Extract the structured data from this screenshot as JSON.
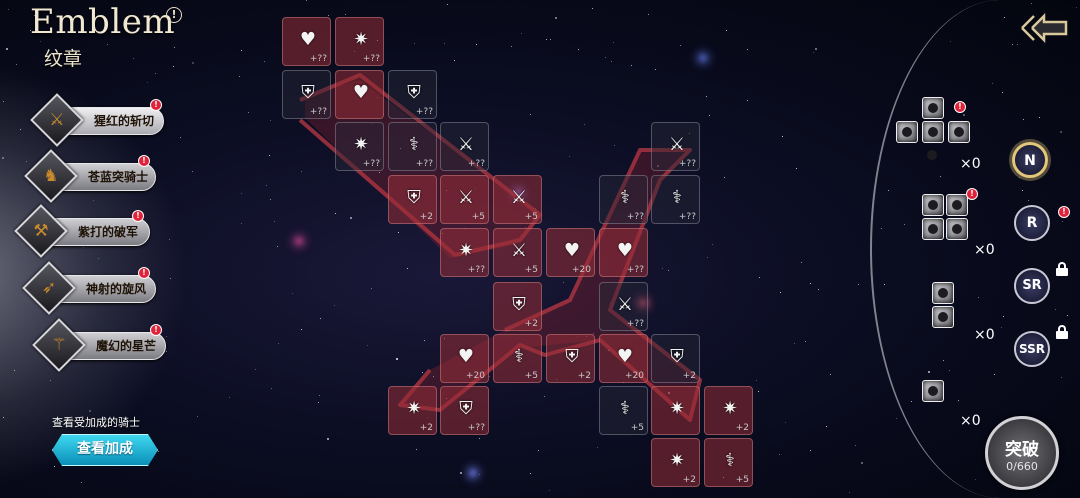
{
  "header": {
    "title": "Emblem",
    "subtitle": "纹章",
    "info_glyph": "!"
  },
  "menu": [
    {
      "label": "猩红的斩切",
      "icon": "sword-icon",
      "badge": "!"
    },
    {
      "label": "苍蓝突骑士",
      "icon": "knight-icon",
      "badge": "!"
    },
    {
      "label": "紫打的破军",
      "icon": "axe-icon",
      "badge": "!"
    },
    {
      "label": "神射的旋风",
      "icon": "bow-icon",
      "badge": "!"
    },
    {
      "label": "魔幻的星芒",
      "icon": "staff-icon",
      "badge": "!"
    }
  ],
  "view_knights": {
    "label": "查看受加成的骑士",
    "button": "查看加成"
  },
  "grid": [
    {
      "icon": "heart-icon",
      "value": "+??",
      "style": "red"
    },
    {
      "icon": "burst-icon",
      "value": "+??",
      "style": "red"
    },
    {
      "icon": "shield-icon",
      "value": "+??",
      "style": "grey"
    },
    {
      "icon": "heart-icon",
      "value": "",
      "style": "red"
    },
    {
      "icon": "shield-icon",
      "value": "+??",
      "style": "grey"
    },
    {
      "icon": "burst-icon",
      "value": "+??",
      "style": "grey"
    },
    {
      "icon": "wand-icon",
      "value": "+??",
      "style": "grey"
    },
    {
      "icon": "sword-icon",
      "value": "+??",
      "style": "grey"
    },
    {
      "icon": "shield-icon",
      "value": "+2",
      "style": "red"
    },
    {
      "icon": "sword-icon",
      "value": "+5",
      "style": "red"
    },
    {
      "icon": "sword-icon",
      "value": "+5",
      "style": "red"
    },
    {
      "icon": "burst-icon",
      "value": "+??",
      "style": "red"
    },
    {
      "icon": "sword-icon",
      "value": "+5",
      "style": "red"
    },
    {
      "icon": "heart-icon",
      "value": "+20",
      "style": "red"
    },
    {
      "icon": "heart-icon",
      "value": "+??",
      "style": "red"
    },
    {
      "icon": "sword-icon",
      "value": "+??",
      "style": "grey"
    },
    {
      "icon": "wand-icon",
      "value": "+??",
      "style": "grey"
    },
    {
      "icon": "wand-icon",
      "value": "+??",
      "style": "grey"
    },
    {
      "icon": "shield-icon",
      "value": "+2",
      "style": "red"
    },
    {
      "icon": "sword-icon",
      "value": "+??",
      "style": "grey"
    },
    {
      "icon": "heart-icon",
      "value": "+20",
      "style": "red"
    },
    {
      "icon": "wand-icon",
      "value": "+5",
      "style": "red"
    },
    {
      "icon": "shield-icon",
      "value": "+2",
      "style": "red"
    },
    {
      "icon": "heart-icon",
      "value": "+20",
      "style": "red"
    },
    {
      "icon": "shield-icon",
      "value": "+2",
      "style": "grey"
    },
    {
      "icon": "burst-icon",
      "value": "+2",
      "style": "red"
    },
    {
      "icon": "shield-icon",
      "value": "+??",
      "style": "red"
    },
    {
      "icon": "wand-icon",
      "value": "+5",
      "style": "grey"
    },
    {
      "icon": "burst-icon",
      "value": "",
      "style": "red"
    },
    {
      "icon": "burst-icon",
      "value": "+2",
      "style": "red"
    },
    {
      "icon": "burst-icon",
      "value": "+2",
      "style": "red"
    },
    {
      "icon": "wand-icon",
      "value": "+5",
      "style": "red"
    }
  ],
  "pieces": [
    {
      "shape": "cross",
      "count": "×0",
      "badge": "!"
    },
    {
      "shape": "square",
      "count": "×0",
      "badge": "!"
    },
    {
      "shape": "bar",
      "count": "×0",
      "badge": ""
    },
    {
      "shape": "single",
      "count": "×0",
      "badge": ""
    }
  ],
  "ranks": [
    {
      "label": "N",
      "state": "active",
      "badge": ""
    },
    {
      "label": "R",
      "state": "normal",
      "badge": "!"
    },
    {
      "label": "SR",
      "state": "locked",
      "badge": ""
    },
    {
      "label": "SSR",
      "state": "locked",
      "badge": ""
    }
  ],
  "breakthrough": {
    "label": "突破",
    "count": "0/660"
  },
  "icons": {
    "back": "back-arrow-icon",
    "lock": "lock-icon"
  }
}
